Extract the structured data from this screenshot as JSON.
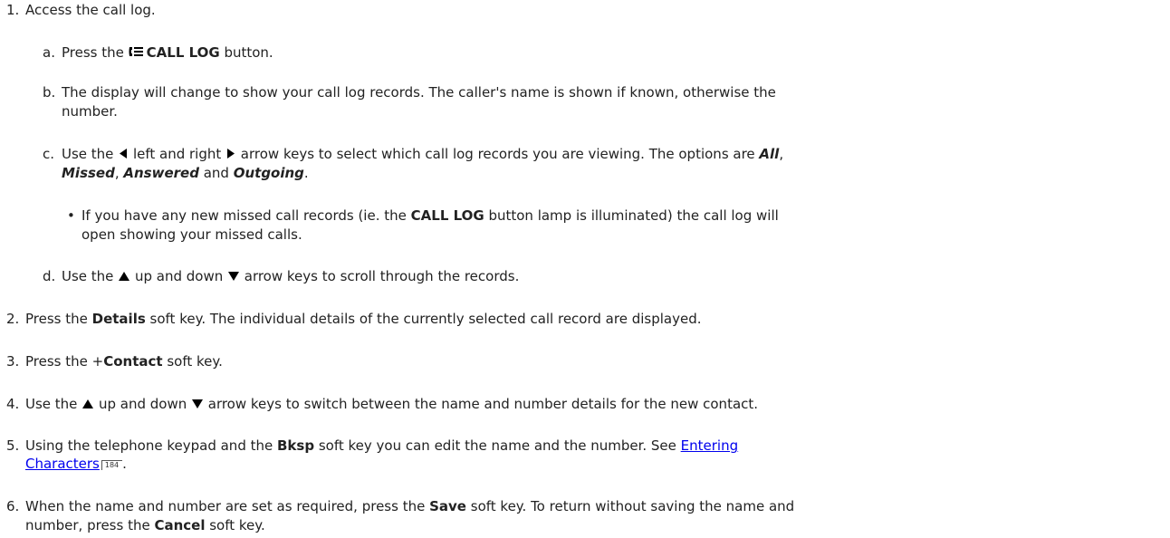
{
  "steps": [
    {
      "num": "1.",
      "text": "Access the call log."
    },
    {
      "num": "a.",
      "pre": "Press the ",
      "bold": "CALL LOG",
      "post": " button.",
      "icon": "call-log-icon"
    },
    {
      "num": "b.",
      "line1": "The display will change to show your call log records. The caller's name is shown if known, otherwise the",
      "line2": "number."
    },
    {
      "num": "c.",
      "p1": "Use the ",
      "p2": " left and right ",
      "p3": " arrow keys to select which call log records you are viewing. The options are ",
      "opt_all": "All",
      "comma1": ",",
      "opt_missed": "Missed",
      "comma2": ", ",
      "opt_answered": "Answered",
      "and": " and ",
      "opt_outgoing": "Outgoing",
      "end": "."
    },
    {
      "num": "•",
      "p1": "If you have any new missed call records (ie. the ",
      "bold": "CALL LOG",
      "p2": " button lamp is illuminated) the call log will",
      "line2": "open showing your missed calls."
    },
    {
      "num": "d.",
      "p1": "Use the ",
      "p2": " up and down ",
      "p3": " arrow keys to scroll through the records."
    },
    {
      "num": "2.",
      "p1": "Press the ",
      "bold": "Details",
      "p2": " soft key. The individual details of the currently selected call record are displayed."
    },
    {
      "num": "3.",
      "p1": "Press the +",
      "bold": "Contact",
      "p2": " soft key."
    },
    {
      "num": "4.",
      "p1": "Use the ",
      "p2": " up and down ",
      "p3": " arrow keys to switch between the name and number details for the new contact."
    },
    {
      "num": "5.",
      "p1": "Using the telephone keypad and the ",
      "bold": "Bksp",
      "p2": " soft key you can edit the name and the number. See ",
      "link1": "Entering",
      "link2": "Characters",
      "pageref": "184",
      "end": "."
    },
    {
      "num": "6.",
      "p1": "When the name and number are set as required, press the ",
      "bold1": "Save",
      "p2": " soft key. To return without saving the name and",
      "p3": "number, press the ",
      "bold2": "Cancel",
      "p4": " soft key."
    }
  ],
  "icons": {
    "call_log": "call-log-icon",
    "left": "left-arrow-icon",
    "right": "right-arrow-icon",
    "up": "up-arrow-icon",
    "down": "down-arrow-icon"
  }
}
